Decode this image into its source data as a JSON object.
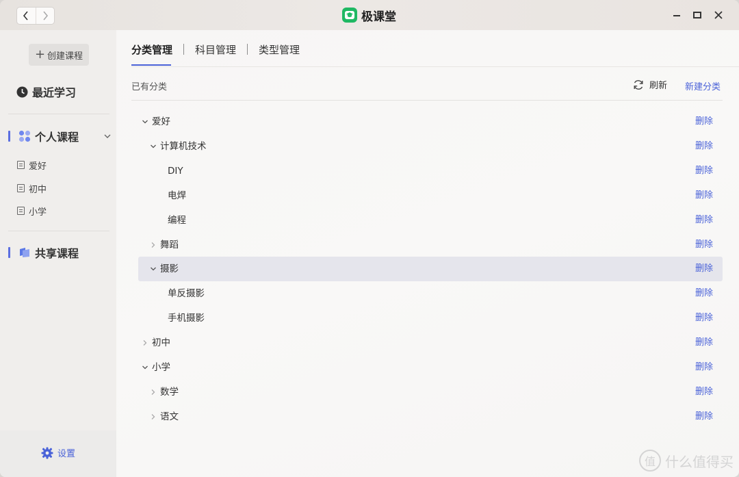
{
  "app": {
    "title": "极课堂"
  },
  "sidebar": {
    "create_label": "创建课程",
    "recent_label": "最近学习",
    "personal_label": "个人课程",
    "personal_items": [
      {
        "label": "爱好"
      },
      {
        "label": "初中"
      },
      {
        "label": "小学"
      }
    ],
    "shared_label": "共享课程",
    "settings_label": "设置"
  },
  "tabs": [
    {
      "label": "分类管理",
      "active": true
    },
    {
      "label": "科目管理",
      "active": false
    },
    {
      "label": "类型管理",
      "active": false
    }
  ],
  "header": {
    "existing_label": "已有分类",
    "refresh_label": "刷新",
    "new_label": "新建分类"
  },
  "tree": [
    {
      "label": "爱好",
      "level": 0,
      "expander": "expanded",
      "delete": "删除"
    },
    {
      "label": "计算机技术",
      "level": 1,
      "expander": "expanded",
      "delete": "删除"
    },
    {
      "label": "DIY",
      "level": 2,
      "expander": "none",
      "delete": "删除"
    },
    {
      "label": "电焊",
      "level": 2,
      "expander": "none",
      "delete": "删除"
    },
    {
      "label": "编程",
      "level": 2,
      "expander": "none",
      "delete": "删除"
    },
    {
      "label": "舞蹈",
      "level": 1,
      "expander": "collapsed",
      "delete": "删除"
    },
    {
      "label": "摄影",
      "level": 1,
      "expander": "expanded",
      "delete": "删除",
      "selected": true
    },
    {
      "label": "单反摄影",
      "level": 2,
      "expander": "none",
      "delete": "删除"
    },
    {
      "label": "手机摄影",
      "level": 2,
      "expander": "none",
      "delete": "删除"
    },
    {
      "label": "初中",
      "level": 0,
      "expander": "collapsed",
      "delete": "删除"
    },
    {
      "label": "小学",
      "level": 0,
      "expander": "expanded",
      "delete": "删除"
    },
    {
      "label": "数学",
      "level": 1,
      "expander": "collapsed",
      "delete": "删除"
    },
    {
      "label": "语文",
      "level": 1,
      "expander": "collapsed",
      "delete": "删除"
    }
  ],
  "watermark": {
    "text": "什么值得买",
    "logo_char": "值"
  },
  "colors": {
    "accent": "#4a62d8",
    "logo": "#1fb863",
    "selected_row": "#e5e5ec"
  }
}
